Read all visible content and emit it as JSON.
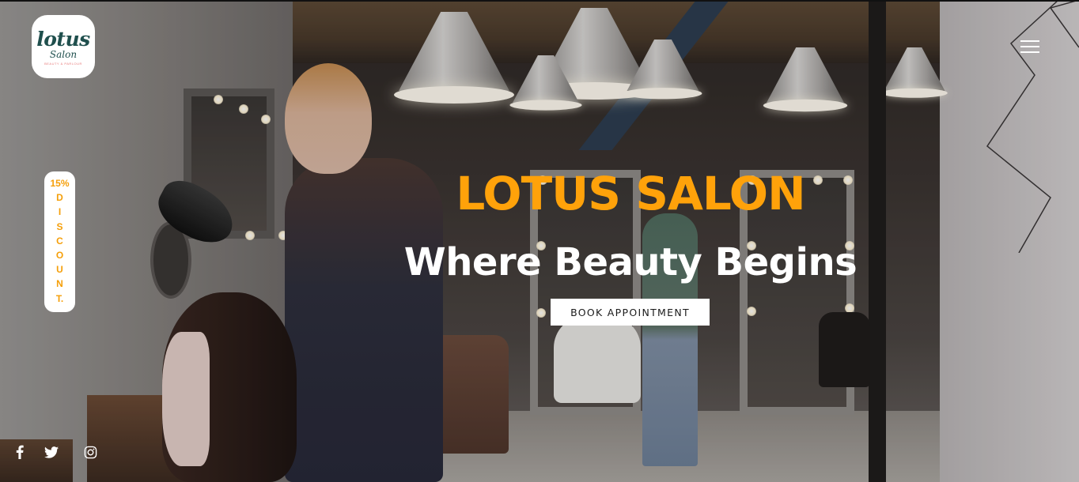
{
  "brand": {
    "logo_main": "lotus",
    "logo_sub": "Salon",
    "logo_tagline": "beauty & parlour"
  },
  "hero": {
    "title": "LOTUS SALON",
    "subtitle": "Where Beauty Begins",
    "cta_label": "BOOK APPOINTMENT",
    "title_color": "#ffa20a"
  },
  "discount_badge": {
    "percent": "15%",
    "letters": [
      "D",
      "I",
      "S",
      "C",
      "O",
      "U",
      "N",
      "T."
    ]
  },
  "menu": {
    "icon": "hamburger-menu-icon"
  },
  "social": [
    {
      "name": "facebook",
      "icon": "facebook-icon"
    },
    {
      "name": "twitter",
      "icon": "twitter-icon"
    },
    {
      "name": "instagram",
      "icon": "instagram-icon"
    }
  ],
  "colors": {
    "accent": "#ffa20a",
    "logo_text": "#1f4f4d",
    "button_bg": "#ffffff"
  }
}
